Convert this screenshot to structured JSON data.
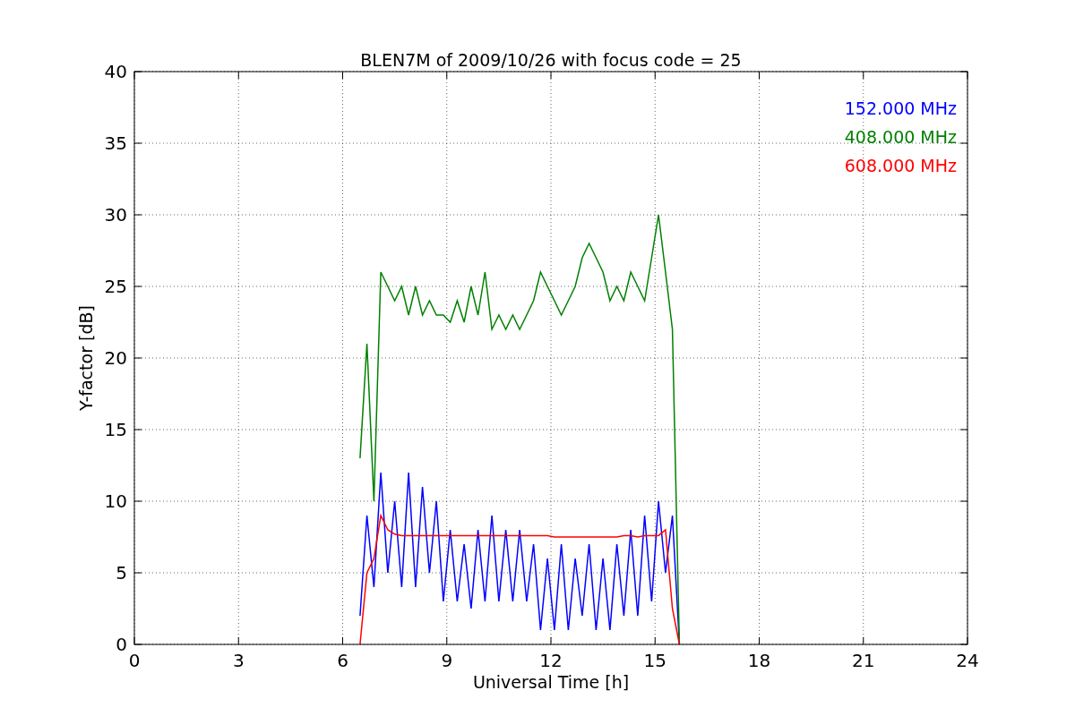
{
  "figure": {
    "chart_data": {
      "type": "line",
      "title": "BLEN7M of 2009/10/26 with focus code = 25",
      "xlabel": "Universal Time [h]",
      "ylabel": "Y-factor [dB]",
      "xlim": [
        0,
        24
      ],
      "ylim": [
        0,
        40
      ],
      "grid": true,
      "xticks": [
        0,
        3,
        6,
        9,
        12,
        15,
        18,
        21,
        24
      ],
      "yticks": [
        0,
        5,
        10,
        15,
        20,
        25,
        30,
        35,
        40
      ],
      "x": [
        6.5,
        6.7,
        6.9,
        7.1,
        7.3,
        7.5,
        7.7,
        7.9,
        8.1,
        8.3,
        8.5,
        8.7,
        8.9,
        9.1,
        9.3,
        9.5,
        9.7,
        9.9,
        10.1,
        10.3,
        10.5,
        10.7,
        10.9,
        11.1,
        11.3,
        11.5,
        11.7,
        11.9,
        12.1,
        12.3,
        12.5,
        12.7,
        12.9,
        13.1,
        13.3,
        13.5,
        13.7,
        13.9,
        14.1,
        14.3,
        14.5,
        14.7,
        14.9,
        15.1,
        15.3,
        15.5,
        15.7
      ],
      "series": [
        {
          "name": "152.000 MHz",
          "color": "#0000ff",
          "values": [
            2,
            9,
            4,
            12,
            5,
            10,
            4,
            12,
            4,
            11,
            5,
            10,
            3,
            8,
            3,
            7,
            2.5,
            8,
            3,
            9,
            3,
            8,
            3,
            8,
            3,
            7,
            1,
            6,
            1,
            7,
            1,
            6,
            2,
            7,
            1,
            6,
            1,
            7,
            2,
            8,
            2,
            9,
            3,
            10,
            5,
            9,
            0
          ]
        },
        {
          "name": "408.000 MHz",
          "color": "#008000",
          "values": [
            13,
            21,
            10,
            26,
            25,
            24,
            25,
            23,
            25,
            23,
            24,
            23,
            23,
            22.5,
            24,
            22.5,
            25,
            23,
            26,
            22,
            23,
            22,
            23,
            22,
            23,
            24,
            26,
            25,
            24,
            23,
            24,
            25,
            27,
            28,
            27,
            26,
            24,
            25,
            24,
            26,
            25,
            24,
            27,
            30,
            26,
            22,
            0
          ]
        },
        {
          "name": "608.000 MHz",
          "color": "#ff0000",
          "values": [
            0,
            5,
            6,
            9,
            8,
            7.7,
            7.6,
            7.6,
            7.6,
            7.6,
            7.6,
            7.6,
            7.6,
            7.6,
            7.6,
            7.6,
            7.6,
            7.6,
            7.6,
            7.6,
            7.6,
            7.6,
            7.6,
            7.6,
            7.6,
            7.6,
            7.6,
            7.6,
            7.5,
            7.5,
            7.5,
            7.5,
            7.5,
            7.5,
            7.5,
            7.5,
            7.5,
            7.5,
            7.6,
            7.6,
            7.5,
            7.6,
            7.6,
            7.6,
            8,
            2.5,
            0
          ]
        }
      ]
    }
  }
}
